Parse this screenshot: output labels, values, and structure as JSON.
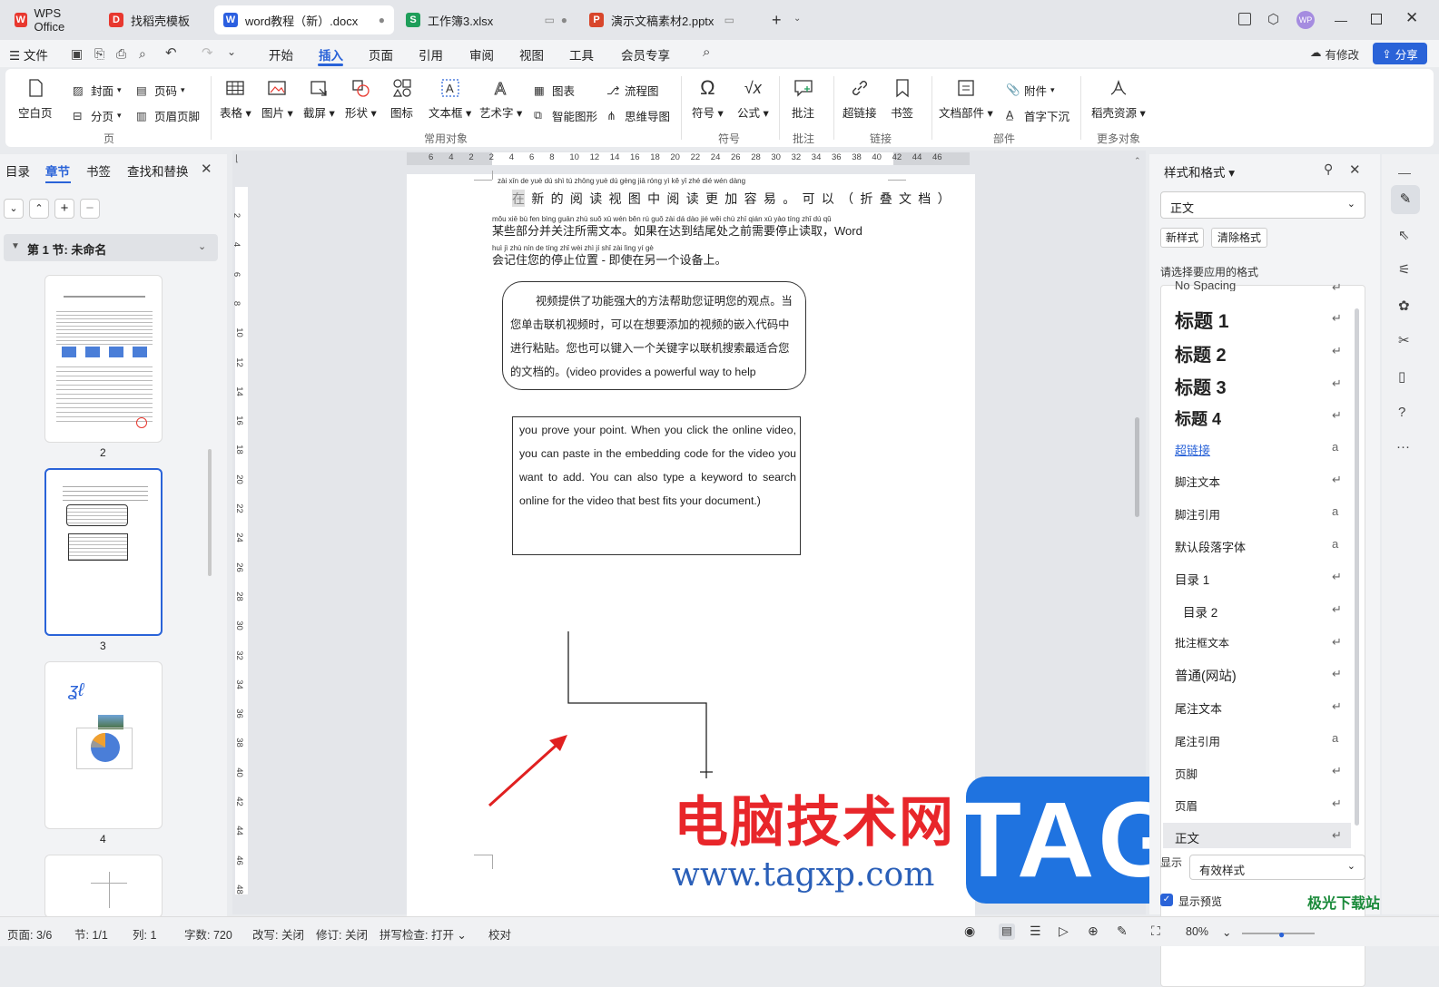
{
  "tabs": [
    {
      "label": "WPS Office",
      "icon": "wps-logo-icon"
    },
    {
      "label": "找稻壳模板",
      "icon": "docer-icon"
    },
    {
      "label": "word教程（新）.docx",
      "icon": "word-icon"
    },
    {
      "label": "工作簿3.xlsx",
      "icon": "sheet-icon"
    },
    {
      "label": "演示文稿素材2.pptx",
      "icon": "ppt-icon"
    }
  ],
  "title_right": {
    "modify_label": "有修改",
    "share_label": "分享"
  },
  "menu": {
    "file_label": "文件",
    "items": [
      "开始",
      "插入",
      "页面",
      "引用",
      "审阅",
      "视图",
      "工具",
      "会员专享"
    ],
    "active_index": 1
  },
  "ribbon": {
    "page_group": {
      "blank": "空白页",
      "cover": "封面",
      "section": "分页",
      "page_num": "页码",
      "header_footer": "页眉页脚",
      "label": "页"
    },
    "common_group": {
      "table": "表格",
      "picture": "图片",
      "screenshot": "截屏",
      "shape": "形状",
      "icon": "图标",
      "textbox": "文本框",
      "wordart": "艺术字",
      "chart": "图表",
      "smart": "智能图形",
      "flow": "流程图",
      "mind": "思维导图",
      "label": "常用对象"
    },
    "symbol_group": {
      "symbol": "符号",
      "formula": "公式",
      "label": "符号"
    },
    "comment_group": {
      "comment": "批注",
      "label": "批注"
    },
    "link_group": {
      "hyperlink": "超链接",
      "bookmark": "书签",
      "label": "链接"
    },
    "part_group": {
      "doc_part": "文档部件",
      "attachment": "附件",
      "dropcap": "首字下沉",
      "label": "部件"
    },
    "more_group": {
      "docer_res": "稻壳资源",
      "label": "更多对象"
    }
  },
  "left_panel": {
    "tabs": [
      "目录",
      "章节",
      "书签",
      "查找和替换"
    ],
    "active_tab": 1,
    "section_title": "第 1 节: 未命名",
    "pages": [
      "2",
      "3",
      "4"
    ]
  },
  "ruler_top": [
    "6",
    "4",
    "2",
    "2",
    "4",
    "6",
    "8",
    "10",
    "12",
    "14",
    "16",
    "18",
    "20",
    "22",
    "24",
    "26",
    "28",
    "30",
    "32",
    "34",
    "36",
    "38",
    "40",
    "42",
    "44",
    "46"
  ],
  "ruler_left": [
    "2",
    "4",
    "6",
    "8",
    "10",
    "12",
    "14",
    "16",
    "18",
    "20",
    "22",
    "24",
    "26",
    "28",
    "30",
    "32",
    "34",
    "36",
    "38",
    "40",
    "42",
    "44",
    "46",
    "48"
  ],
  "document": {
    "pinyin_line1": "zài  xīn  de  yuè  dú  shì  tú  zhōng  yuè  dú  gèng  jiā  róng  yì     kě  yǐ     zhé  dié  wén  dàng",
    "line1": "在新的阅读视图中阅读更加容易。可以（折叠文档）",
    "pinyin_line2": "mǒu xiē bù fen bìng guān zhù suǒ xū wén běn    rú  guǒ  zài  dá  dào  jié  wěi  chù  zhī  qián  xū  yào  tíng  zhǐ  dú  qǔ",
    "line2": "某些部分并关注所需文本。如果在达到结尾处之前需要停止读取，Word",
    "pinyin_line3": "huì  jì  zhù  nín  de  tíng  zhǐ  wèi  zhì        jí  shǐ  zài  lìng  yí  gè",
    "line3": "会记住您的停止位置 - 即使在另一个设备上。",
    "box1": "视频提供了功能强大的方法帮助您证明您的观点。当您单击联机视频时，可以在想要添加的视频的嵌入代码中进行粘贴。您也可以键入一个关键字以联机搜索最适合您的文档的。(video provides a powerful way to help",
    "box2": "you prove your point. When you click the online video, you can paste in the embedding code for the video you want to add. You can also type a keyword to search online for the video that best fits your document.)"
  },
  "watermark": {
    "text": "电脑技术网",
    "url": "www.tagxp.com",
    "tag": "TAG"
  },
  "right_panel": {
    "title": "样式和格式",
    "current_style": "正文",
    "new_style": "新样式",
    "clear_format": "清除格式",
    "prompt": "请选择要应用的格式",
    "styles": [
      "No Spacing",
      "标题 1",
      "标题 2",
      "标题 3",
      "标题 4",
      "超链接",
      "脚注文本",
      "脚注引用",
      "默认段落字体",
      "目录 1",
      "目录 2",
      "批注框文本",
      "普通(网站)",
      "尾注文本",
      "尾注引用",
      "页脚",
      "页眉",
      "正文"
    ],
    "show_label": "显示",
    "show_value": "有效样式",
    "preview_label": "显示预览"
  },
  "status": {
    "page": "页面: 3/6",
    "section": "节: 1/1",
    "column": "列: 1",
    "words": "字数: 720",
    "track_change": "改写: 关闭",
    "revision": "修订: 关闭",
    "spell": "拼写检查: 打开",
    "proof": "校对",
    "zoom": "80%"
  },
  "corner_watermark": "极光下载站",
  "colors": {
    "accent": "#2a63d8",
    "wps_red": "#e8382f",
    "tag_blue": "#1f73e0",
    "watermark_red": "#e8262a"
  }
}
